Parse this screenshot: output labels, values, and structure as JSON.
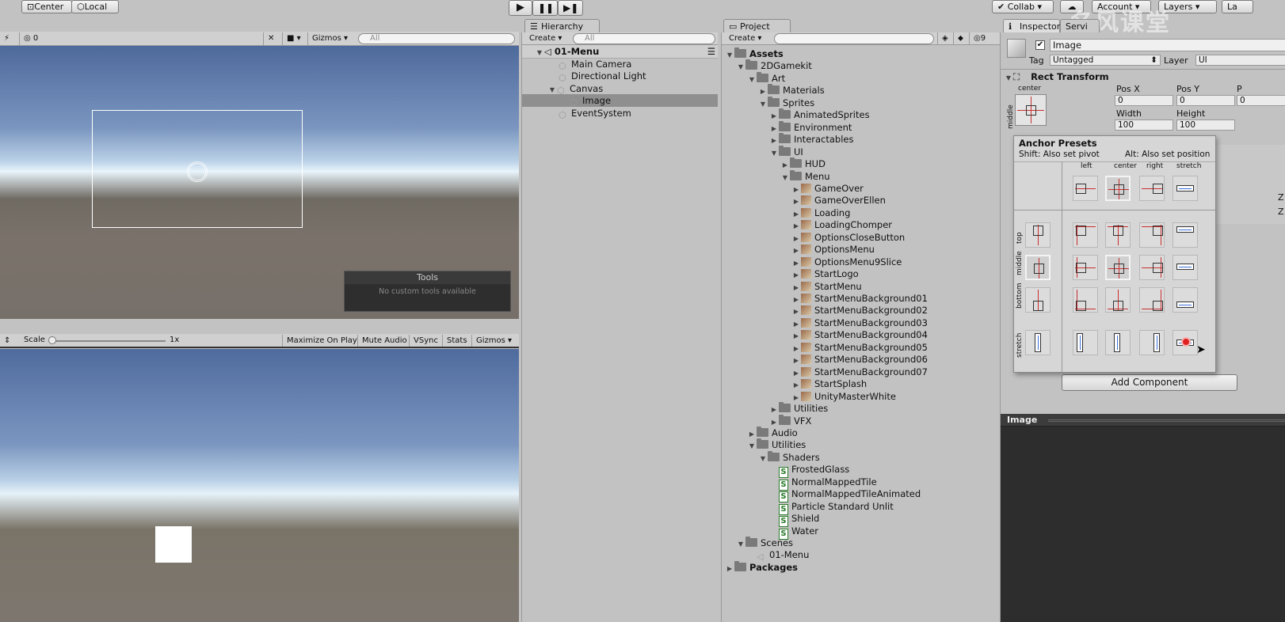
{
  "toolbar": {
    "center_label": "Center",
    "local_label": "Local",
    "collab_label": "Collab",
    "account_label": "Account",
    "layers_label": "Layers",
    "layout_label": "La"
  },
  "scene": {
    "hidden_count": "0",
    "gizmos_label": "Gizmos",
    "search_placeholder": "All",
    "tools_title": "Tools",
    "tools_message": "No custom tools available"
  },
  "game": {
    "scale_label": "Scale",
    "scale_value": "1x",
    "maximize_label": "Maximize On Play",
    "mute_label": "Mute Audio",
    "vsync_label": "VSync",
    "stats_label": "Stats",
    "gizmos_label": "Gizmos"
  },
  "hierarchy": {
    "tab_label": "Hierarchy",
    "create_label": "Create",
    "search_placeholder": "All",
    "scene_name": "01-Menu",
    "items": [
      {
        "label": "Main Camera"
      },
      {
        "label": "Directional Light"
      },
      {
        "label": "Canvas"
      },
      {
        "label": "Image"
      },
      {
        "label": "EventSystem"
      }
    ]
  },
  "project": {
    "tab_label": "Project",
    "create_label": "Create",
    "hidden_count": "9",
    "tree": [
      {
        "label": "Assets"
      },
      {
        "label": "2DGamekit"
      },
      {
        "label": "Art"
      },
      {
        "label": "Materials"
      },
      {
        "label": "Sprites"
      },
      {
        "label": "AnimatedSprites"
      },
      {
        "label": "Environment"
      },
      {
        "label": "Interactables"
      },
      {
        "label": "UI"
      },
      {
        "label": "HUD"
      },
      {
        "label": "Menu"
      },
      {
        "label": "GameOver"
      },
      {
        "label": "GameOverEllen"
      },
      {
        "label": "Loading"
      },
      {
        "label": "LoadingChomper"
      },
      {
        "label": "OptionsCloseButton"
      },
      {
        "label": "OptionsMenu"
      },
      {
        "label": "OptionsMenu9Slice"
      },
      {
        "label": "StartLogo"
      },
      {
        "label": "StartMenu"
      },
      {
        "label": "StartMenuBackground01"
      },
      {
        "label": "StartMenuBackground02"
      },
      {
        "label": "StartMenuBackground03"
      },
      {
        "label": "StartMenuBackground04"
      },
      {
        "label": "StartMenuBackground05"
      },
      {
        "label": "StartMenuBackground06"
      },
      {
        "label": "StartMenuBackground07"
      },
      {
        "label": "StartSplash"
      },
      {
        "label": "UnityMasterWhite"
      },
      {
        "label": "Utilities"
      },
      {
        "label": "VFX"
      },
      {
        "label": "Audio"
      },
      {
        "label": "Utilities"
      },
      {
        "label": "Shaders"
      },
      {
        "label": "FrostedGlass"
      },
      {
        "label": "NormalMappedTile"
      },
      {
        "label": "NormalMappedTileAnimated"
      },
      {
        "label": "Particle Standard Unlit"
      },
      {
        "label": "Shield"
      },
      {
        "label": "Water"
      },
      {
        "label": "Scenes"
      },
      {
        "label": "01-Menu"
      },
      {
        "label": "Packages"
      }
    ]
  },
  "inspector": {
    "tab_label": "Inspector",
    "tab2_label": "Servi",
    "object_name": "Image",
    "tag_label": "Tag",
    "tag_value": "Untagged",
    "layer_label": "Layer",
    "layer_value": "UI",
    "rect_title": "Rect Transform",
    "anchor_h": "center",
    "anchor_v": "middle",
    "posx_label": "Pos X",
    "posy_label": "Pos Y",
    "posz_label": "P",
    "posx": "0",
    "posy": "0",
    "posz": "0",
    "width_label": "Width",
    "height_label": "Height",
    "width": "100",
    "height": "100",
    "presets_title": "Anchor Presets",
    "presets_hint_left": "Shift: Also set pivot",
    "presets_hint_right": "Alt: Also set position",
    "col_labels": [
      "left",
      "center",
      "right",
      "stretch"
    ],
    "row_labels": [
      "top",
      "middle",
      "bottom",
      "stretch"
    ],
    "z1": "Z",
    "z2": "Z",
    "add_component": "Add Component",
    "preview_title": "Image"
  },
  "watermark": "名风课堂"
}
